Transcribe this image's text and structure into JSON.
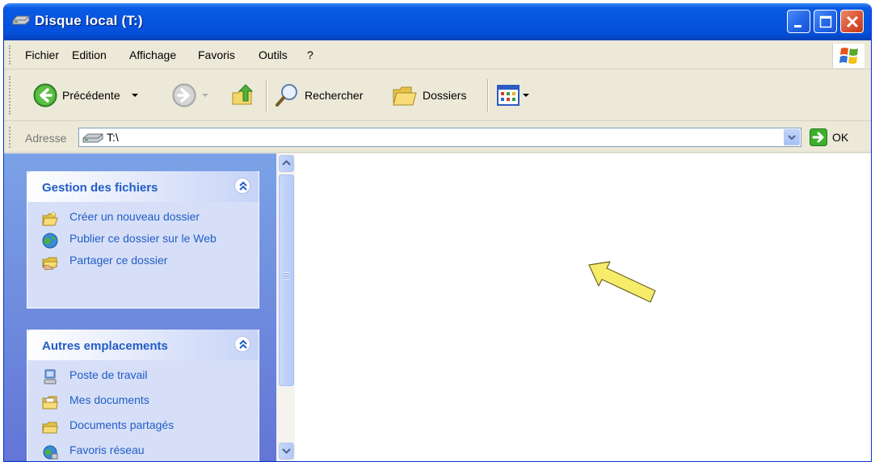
{
  "window": {
    "title": "Disque local (T:)"
  },
  "menu": {
    "items": [
      {
        "label": "Fichier"
      },
      {
        "label": "Edition"
      },
      {
        "label": "Affichage"
      },
      {
        "label": "Favoris"
      },
      {
        "label": "Outils"
      },
      {
        "label": "?"
      }
    ]
  },
  "toolbar": {
    "back_label": "Précédente",
    "search_label": "Rechercher",
    "folders_label": "Dossiers"
  },
  "address": {
    "label": "Adresse",
    "value": "T:\\",
    "go_label": "OK"
  },
  "taskpane": {
    "file_tasks": {
      "title": "Gestion des fichiers",
      "items": [
        {
          "label": "Créer un nouveau dossier",
          "icon": "new-folder-icon"
        },
        {
          "label": "Publier ce dossier sur le Web",
          "icon": "publish-web-icon"
        },
        {
          "label": "Partager ce dossier",
          "icon": "share-folder-icon"
        }
      ]
    },
    "other_places": {
      "title": "Autres emplacements",
      "items": [
        {
          "label": "Poste de travail",
          "icon": "my-computer-icon"
        },
        {
          "label": "Mes documents",
          "icon": "my-documents-icon"
        },
        {
          "label": "Documents partagés",
          "icon": "shared-documents-icon"
        },
        {
          "label": "Favoris réseau",
          "icon": "network-places-icon"
        }
      ]
    }
  },
  "colors": {
    "titlebar": "#0654e0",
    "taskpane_link": "#215dc6",
    "annotation_arrow": "#f6ec6a"
  }
}
